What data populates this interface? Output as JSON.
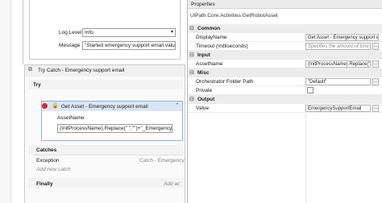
{
  "designer": {
    "log_level_label": "Log Level",
    "log_level_value": "Info",
    "message_label": "Message",
    "message_value": "\"Started emergency support email value ta",
    "try_catch_title": "Try Catch - Emergency support email",
    "try_label": "Try",
    "activity_title": "Get Asset - Emergency support email",
    "asset_name_label": "AssetName",
    "asset_name_value": "(InitProcessName).Replace(\" \",\"\")+\"_Emergency_",
    "catches_label": "Catches",
    "exception_label": "Exception",
    "exception_value": "Catch - Emergency sup",
    "add_new_catch": "Add new catch",
    "finally_label": "Finally",
    "finally_placeholder": "Add ac"
  },
  "properties": {
    "title": "Properties",
    "activity_type": "UiPath.Core.Activities.GetRobotAsset",
    "categories": {
      "common": "Common",
      "input": "Input",
      "misc": "Misc",
      "output": "Output"
    },
    "display_name_label": "DisplayName",
    "display_name_value": "Get Asset - Emergency support en",
    "timeout_label": "Timeout (milliseconds)",
    "timeout_placeholder": "Specifies the amount of time (",
    "asset_name_label": "AssetName",
    "asset_name_value": "(InitProcessName).Replace(\" \"",
    "folder_path_label": "Orchestrator Folder Path",
    "folder_path_value": "\"Default\"",
    "private_label": "Private",
    "value_label": "Value",
    "value_value": "EmergencySupportEmail",
    "toggle_symbol": "⊟",
    "ellipsis": "...",
    "collapse_symbol": "⌃"
  },
  "colors": {
    "accent_blue": "#2d6db5",
    "header_blue": "#dbe6f4",
    "error_red": "#d9262c"
  }
}
